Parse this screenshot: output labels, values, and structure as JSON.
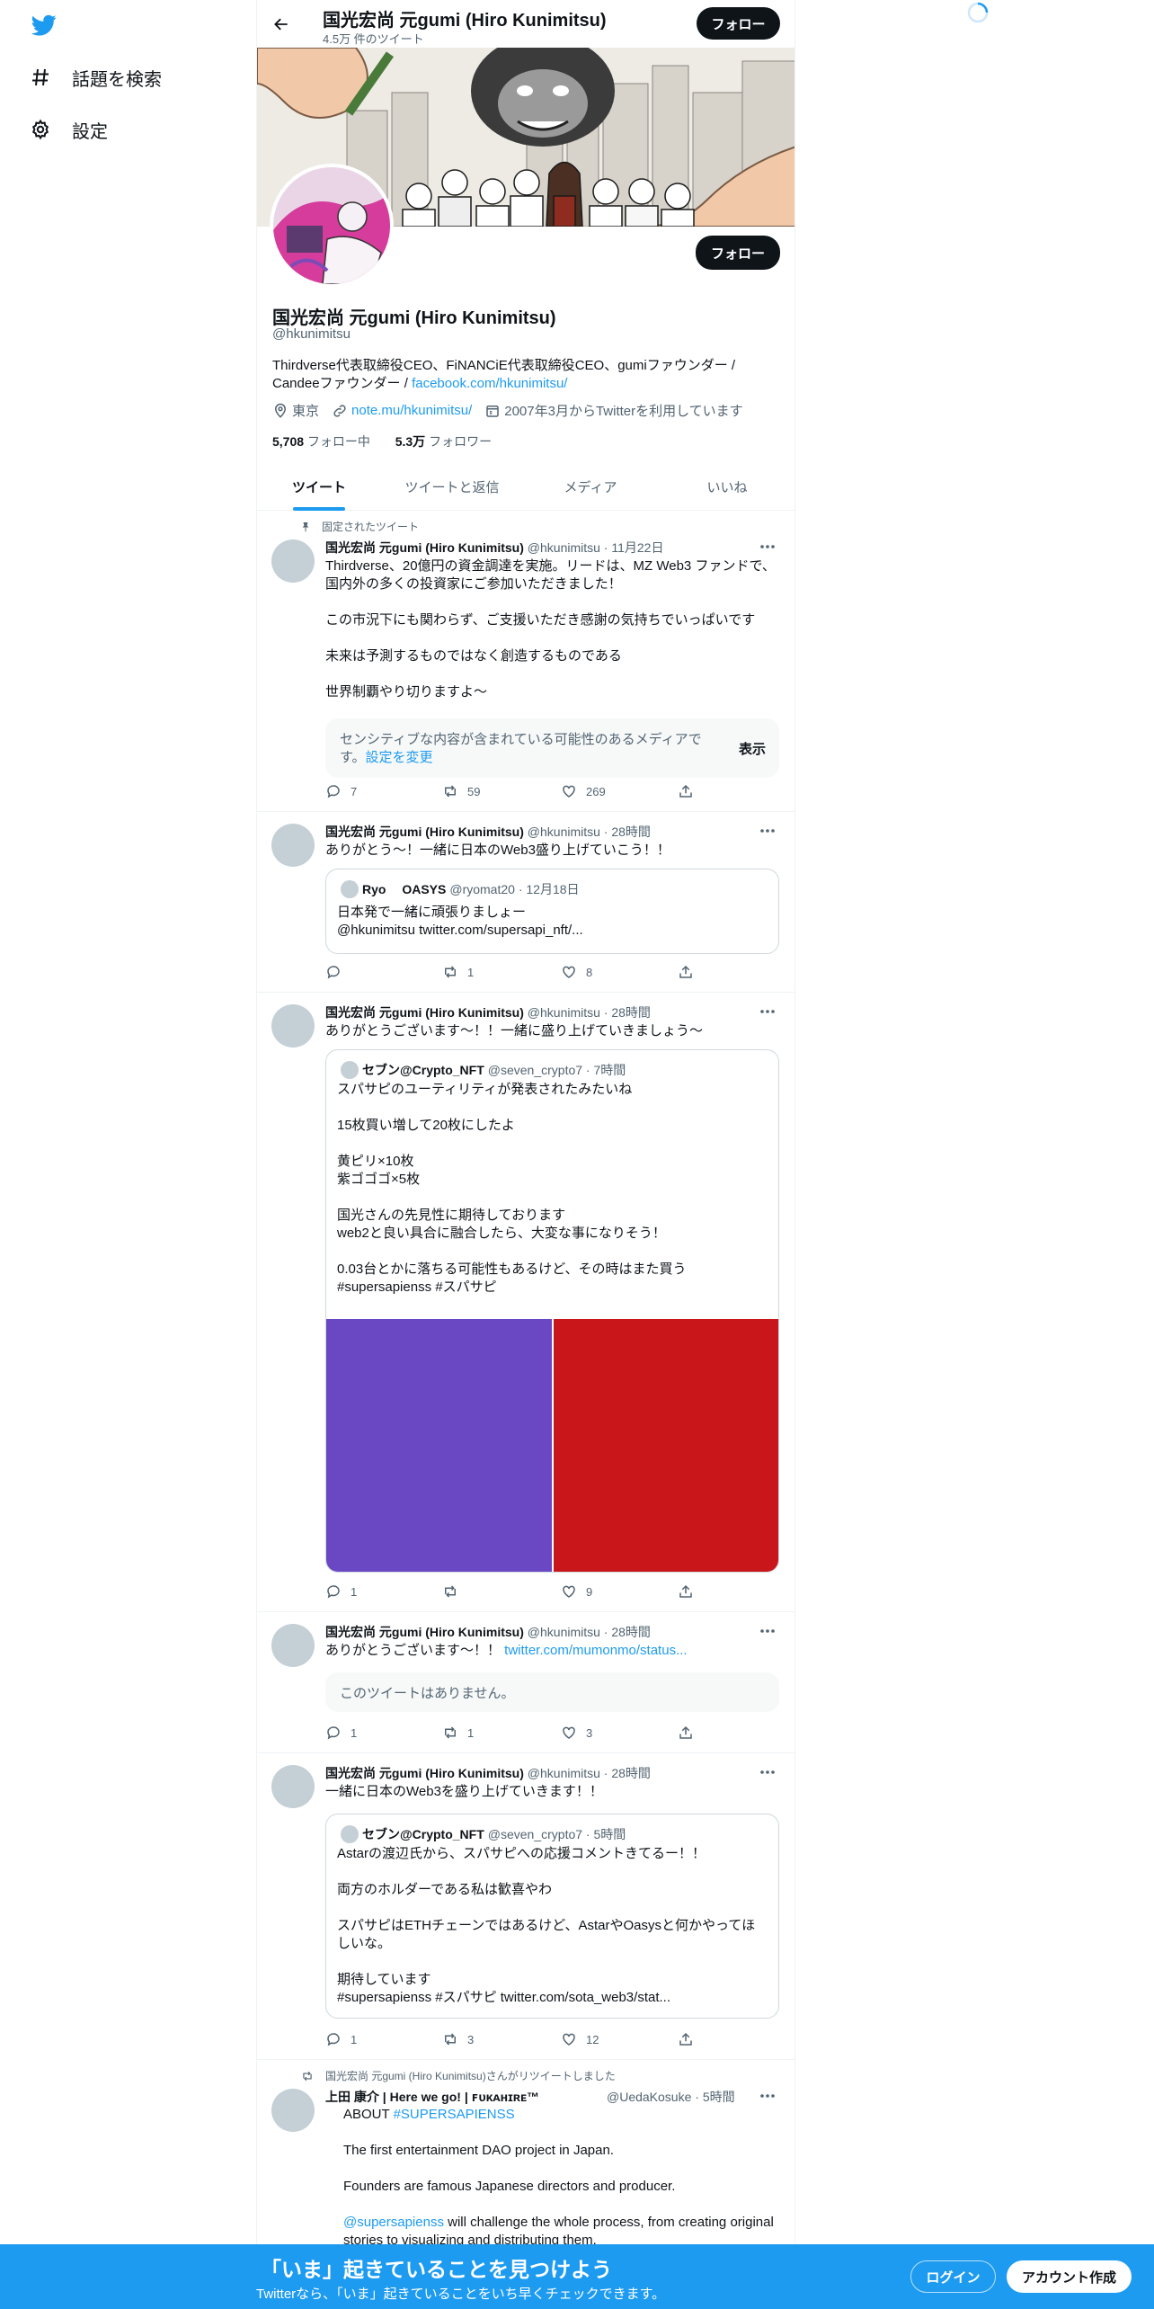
{
  "nav": {
    "explore_label": "話題を検索",
    "settings_label": "設定"
  },
  "profile": {
    "name": "国光宏尚 元gumi (Hiro Kunimitsu)",
    "tweet_count": "4.5万 件のツイート",
    "follow_label": "フォロー",
    "handle": "@hkunimitsu",
    "bio_text": "Thirdverse代表取締役CEO、FiNANCiE代表取締役CEO、gumiファウンダー / Candeeファウンダー / ",
    "bio_link": "facebook.com/hkunimitsu/",
    "location": "東京",
    "website": "note.mu/hkunimitsu/",
    "joined": "2007年3月からTwitterを利用しています",
    "following_count": "5,708",
    "following_label": "フォロー中",
    "followers_count": "5.3万",
    "followers_label": "フォロワー"
  },
  "tabs": [
    "ツイート",
    "ツイートと返信",
    "メディア",
    "いいね"
  ],
  "tweets": [
    {
      "pinned_label": "固定されたツイート",
      "author": "国光宏尚 元gumi (Hiro Kunimitsu)",
      "handle_time": "@hkunimitsu · 11月22日",
      "text": "Thirdverse、20億円の資金調達を実施。リードは、MZ Web3 ファンドで、国内外の多くの投資家にご参加いただきました！\n\nこの市況下にも関わらず、ご支援いただき感謝の気持ちでいっぱいです\n\n未来は予測するものではなく創造するものである\n\n世界制覇やり切りますよ～",
      "sensitive_text": "センシティブな内容が含まれている可能性のあるメディアです。",
      "sensitive_link": "設定を変更",
      "show_label": "表示",
      "replies": "7",
      "retweets": "59",
      "likes": "269"
    },
    {
      "author": "国光宏尚 元gumi (Hiro Kunimitsu)",
      "handle_time": "@hkunimitsu · 28時間",
      "text": "ありがとう〜！一緒に日本のWeb3盛り上げていこう！！",
      "quote_author": "Ryo　 OASYS",
      "quote_handle_time": "@ryomat20 · 12月18日",
      "quote_text": "日本発で一緒に頑張りましょー\n@hkunimitsu twitter.com/supersapi_nft/...",
      "replies": "",
      "retweets": "1",
      "likes": "8"
    },
    {
      "author": "国光宏尚 元gumi (Hiro Kunimitsu)",
      "handle_time": "@hkunimitsu · 28時間",
      "text": "ありがとうございます〜！！一緒に盛り上げていきましょう〜",
      "quote_author": "セブン@Crypto_NFT",
      "quote_handle_time": "@seven_crypto7 · 7時間",
      "quote_text": "スパサピのユーティリティが発表されたみたいね\n\n15枚買い増して20枚にしたよ\n\n黄ピリ×10枚\n紫ゴゴゴ×5枚\n\n国光さんの先見性に期待しております\nweb2と良い具合に融合したら、大変な事になりそう！\n\n0.03台とかに落ちる可能性もあるけど、その時はまた買う\n#supersapienss #スパサピ",
      "media_colors": [
        "#6a48c3",
        "#c9161b"
      ],
      "replies": "1",
      "retweets": "",
      "likes": "9"
    },
    {
      "author": "国光宏尚 元gumi (Hiro Kunimitsu)",
      "handle_time": "@hkunimitsu · 28時間",
      "text": "ありがとうございます〜！！ ",
      "text_link": "twitter.com/mumonmo/status...",
      "unavailable_text": "このツイートはありません。",
      "replies": "1",
      "retweets": "1",
      "likes": "3"
    },
    {
      "author": "国光宏尚 元gumi (Hiro Kunimitsu)",
      "handle_time": "@hkunimitsu · 28時間",
      "text": "一緒に日本のWeb3を盛り上げていきます！！",
      "quote_author": "セブン@Crypto_NFT",
      "quote_handle_time": "@seven_crypto7 · 5時間",
      "quote_text": "Astarの渡辺氏から、スパサピへの応援コメントきてるー！！\n\n両方のホルダーである私は歓喜やわ\n\nスパサピはETHチェーンではあるけど、AstarやOasysと何かやってほしいな。\n\n期待しています\n#supersapienss #スパサピ twitter.com/sota_web3/stat...",
      "replies": "1",
      "retweets": "3",
      "likes": "12"
    },
    {
      "retweet_label": "国光宏尚 元gumi (Hiro Kunimitsu)さんがリツイートしました",
      "author": "上田 康介 | Here we go! | ꜰᴜᴋᴀʜɪʀᴇ™",
      "handle_time": "@UedaKosuke · 5時間",
      "text_prefix": "ABOUT ",
      "text_hashtag": "#SUPERSAPIENSS",
      "line2": "The first entertainment DAO project in Japan.",
      "line3": "Founders are famous Japanese directors and producer.",
      "mention": "@supersapienss",
      "line4_rest": " will challenge the whole process, from creating original stories to visualizing and distributing them."
    }
  ],
  "bottom_bar": {
    "title": "「いま」起きていることを見つけよう",
    "subtitle": "Twitterなら、「いま」起きていることをいち早くチェックできます。",
    "login_label": "ログイン",
    "signup_label": "アカウント作成"
  },
  "colors": {
    "accent": "#1d9bf0",
    "text": "#0f1419",
    "muted": "#536471"
  }
}
